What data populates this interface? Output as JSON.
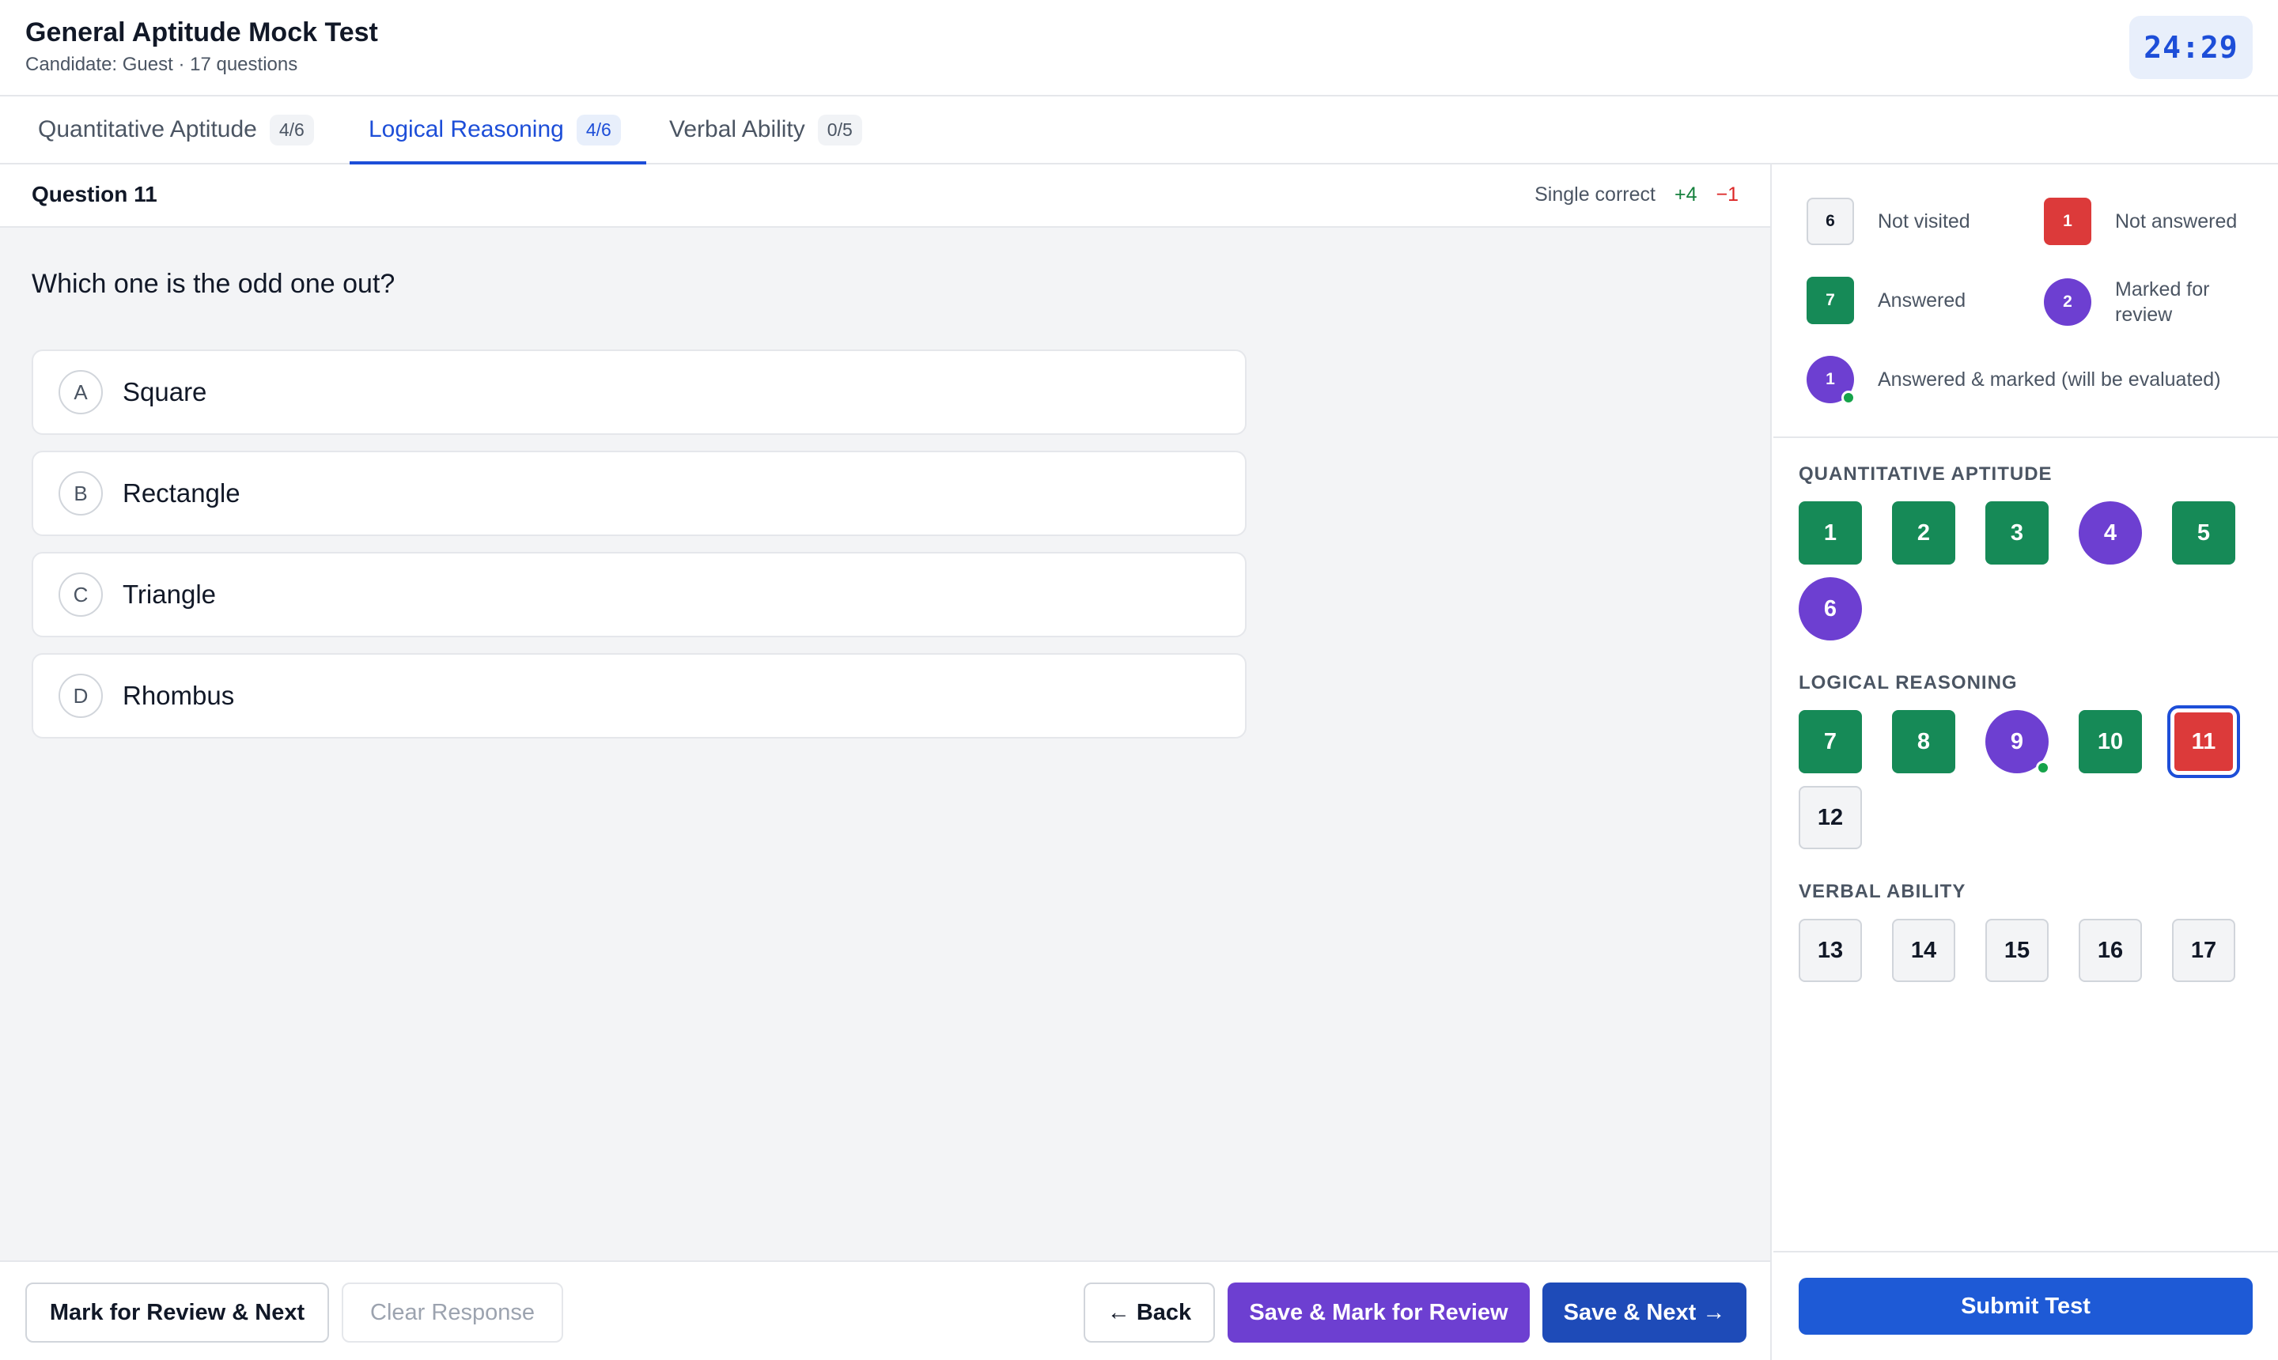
{
  "header": {
    "title": "General Aptitude Mock Test",
    "subtitle": "Candidate: Guest · 17 questions",
    "timer": "24:29"
  },
  "tabs": [
    {
      "label": "Quantitative Aptitude",
      "count": "4/6",
      "active": false
    },
    {
      "label": "Logical Reasoning",
      "count": "4/6",
      "active": true
    },
    {
      "label": "Verbal Ability",
      "count": "0/5",
      "active": false
    }
  ],
  "question": {
    "number_label": "Question 11",
    "type_label": "Single correct",
    "positive_marks": "+4",
    "negative_marks": "−1",
    "text": "Which one is the odd one out?",
    "options": [
      {
        "letter": "A",
        "text": "Square"
      },
      {
        "letter": "B",
        "text": "Rectangle"
      },
      {
        "letter": "C",
        "text": "Triangle"
      },
      {
        "letter": "D",
        "text": "Rhombus"
      }
    ]
  },
  "actions": {
    "mark_review_next": "Mark for Review & Next",
    "clear_response": "Clear Response",
    "back": "← Back",
    "save_mark_review": "Save & Mark for Review",
    "save_next": "Save & Next →"
  },
  "legend": {
    "not_visited": {
      "count": "6",
      "label": "Not visited"
    },
    "not_answered": {
      "count": "1",
      "label": "Not answered"
    },
    "answered": {
      "count": "7",
      "label": "Answered"
    },
    "marked_review": {
      "count": "2",
      "label": "Marked for review"
    },
    "answered_marked": {
      "count": "1",
      "label": "Answered & marked (will be evaluated)"
    }
  },
  "palette": {
    "sections": [
      {
        "title": "QUANTITATIVE APTITUDE",
        "questions": [
          {
            "n": "1",
            "state": "answered"
          },
          {
            "n": "2",
            "state": "answered"
          },
          {
            "n": "3",
            "state": "answered"
          },
          {
            "n": "4",
            "state": "marked"
          },
          {
            "n": "5",
            "state": "answered"
          },
          {
            "n": "6",
            "state": "marked"
          }
        ]
      },
      {
        "title": "LOGICAL REASONING",
        "questions": [
          {
            "n": "7",
            "state": "answered"
          },
          {
            "n": "8",
            "state": "answered"
          },
          {
            "n": "9",
            "state": "answered-marked"
          },
          {
            "n": "10",
            "state": "answered"
          },
          {
            "n": "11",
            "state": "not-answered-current"
          },
          {
            "n": "12",
            "state": "not-visited"
          }
        ]
      },
      {
        "title": "VERBAL ABILITY",
        "questions": [
          {
            "n": "13",
            "state": "not-visited"
          },
          {
            "n": "14",
            "state": "not-visited"
          },
          {
            "n": "15",
            "state": "not-visited"
          },
          {
            "n": "16",
            "state": "not-visited"
          },
          {
            "n": "17",
            "state": "not-visited"
          }
        ]
      }
    ]
  },
  "submit_label": "Submit Test",
  "colors": {
    "answered": "#168a57",
    "not_answered": "#dc3a3a",
    "marked": "#6d3fd1",
    "accent": "#1d4ed8"
  }
}
